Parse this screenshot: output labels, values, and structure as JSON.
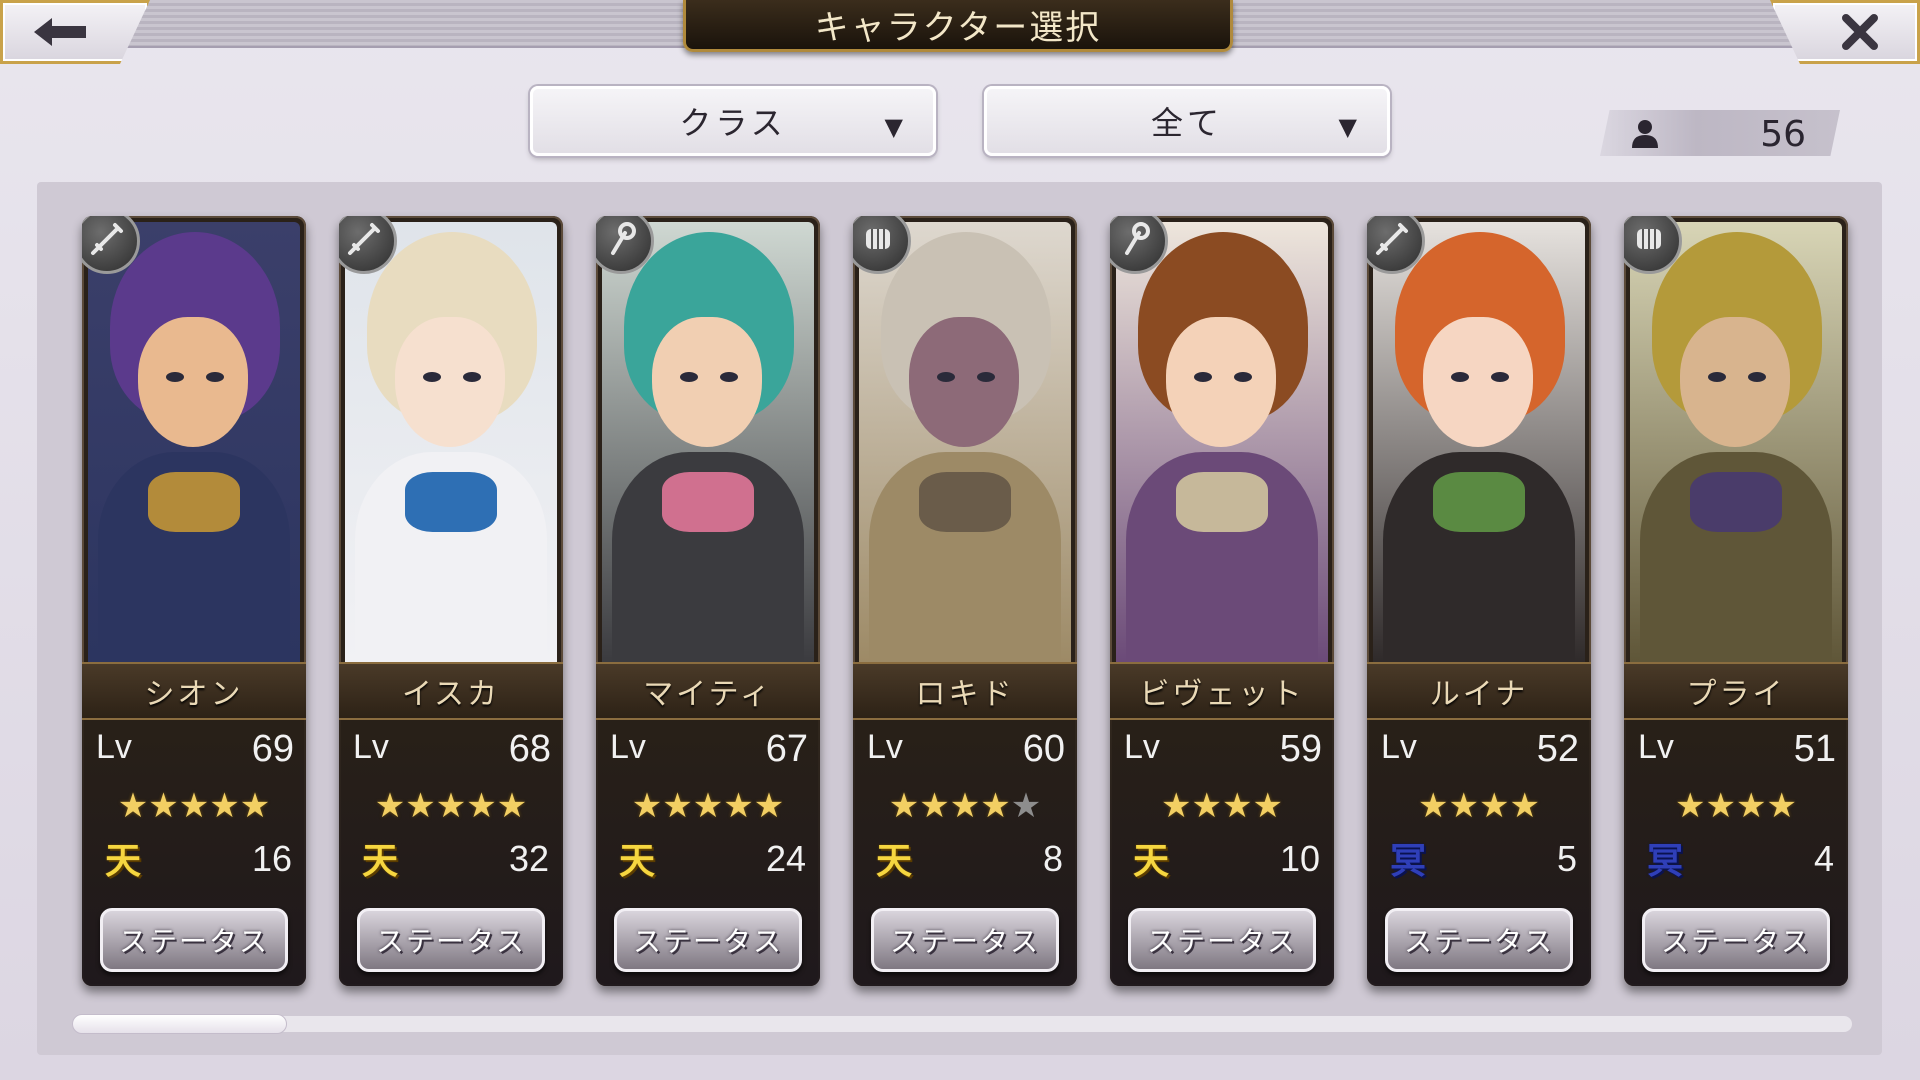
{
  "header": {
    "title": "キャラクター選択",
    "back_icon": "arrow-left-icon",
    "close_icon": "close-icon"
  },
  "filters": {
    "class_label": "クラス",
    "rarity_label": "全て"
  },
  "owned_count": "56",
  "characters": [
    {
      "name": "シオン",
      "lv_label": "Lv",
      "level": "69",
      "stars": 5,
      "max_stars": 5,
      "rank_glyph": "天",
      "rank_type": "gold",
      "rank_value": "16",
      "status_label": "ステータス",
      "class_icon": "sword-icon"
    },
    {
      "name": "イスカ",
      "lv_label": "Lv",
      "level": "68",
      "stars": 5,
      "max_stars": 5,
      "rank_glyph": "天",
      "rank_type": "gold",
      "rank_value": "32",
      "status_label": "ステータス",
      "class_icon": "sword-icon"
    },
    {
      "name": "マイティ",
      "lv_label": "Lv",
      "level": "67",
      "stars": 5,
      "max_stars": 5,
      "rank_glyph": "天",
      "rank_type": "gold",
      "rank_value": "24",
      "status_label": "ステータス",
      "class_icon": "staff-icon"
    },
    {
      "name": "ロキド",
      "lv_label": "Lv",
      "level": "60",
      "stars": 4,
      "max_stars": 5,
      "rank_glyph": "天",
      "rank_type": "gold",
      "rank_value": "8",
      "status_label": "ステータス",
      "class_icon": "fist-icon"
    },
    {
      "name": "ビヴェット",
      "lv_label": "Lv",
      "level": "59",
      "stars": 4,
      "max_stars": 4,
      "rank_glyph": "天",
      "rank_type": "gold",
      "rank_value": "10",
      "status_label": "ステータス",
      "class_icon": "staff-icon"
    },
    {
      "name": "ルイナ",
      "lv_label": "Lv",
      "level": "52",
      "stars": 4,
      "max_stars": 4,
      "rank_glyph": "冥",
      "rank_type": "blue",
      "rank_value": "5",
      "status_label": "ステータス",
      "class_icon": "sword-icon"
    },
    {
      "name": "プライ",
      "lv_label": "Lv",
      "level": "51",
      "stars": 4,
      "max_stars": 4,
      "rank_glyph": "冥",
      "rank_type": "blue",
      "rank_value": "4",
      "status_label": "ステータス",
      "class_icon": "fist-icon"
    }
  ],
  "colors": {
    "accent_gold": "#c9a24a",
    "panel": "#cfc9d4",
    "star": "#f2cf63"
  },
  "scroll_position": 0.0
}
